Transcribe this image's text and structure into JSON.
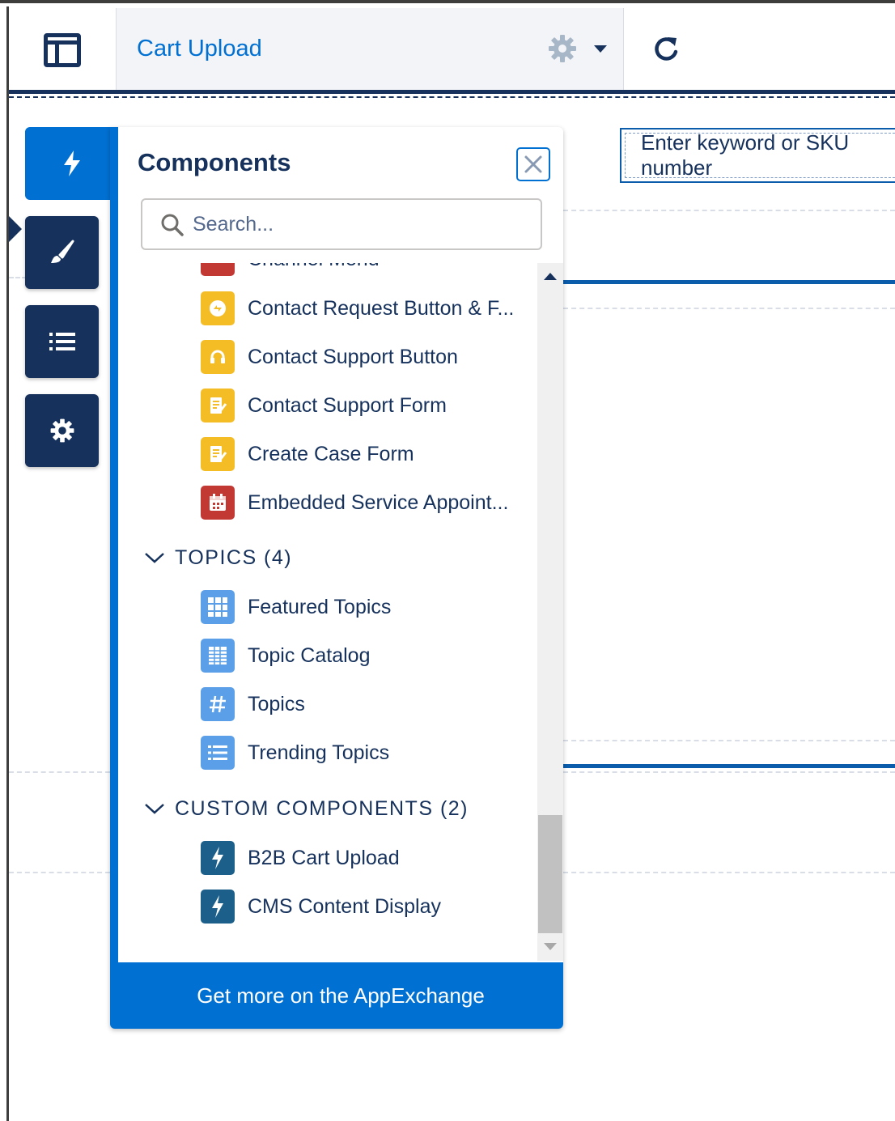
{
  "header": {
    "page_title": "Cart Upload"
  },
  "canvas": {
    "search_placeholder": "Enter keyword or SKU number"
  },
  "rail": {
    "items": [
      {
        "icon": "lightning-icon",
        "active": true
      },
      {
        "icon": "paintbrush-icon",
        "active": false
      },
      {
        "icon": "list-icon",
        "active": false
      },
      {
        "icon": "gear-icon",
        "active": false
      }
    ]
  },
  "panel": {
    "title": "Components",
    "search_placeholder": "Search...",
    "partial_item_label": "Channel Menu",
    "support_items": [
      {
        "label": "Contact Request Button & F...",
        "icon": "contact-request-icon",
        "color": "#f4bc25"
      },
      {
        "label": "Contact Support Button",
        "icon": "headset-icon",
        "color": "#f4bc25"
      },
      {
        "label": "Contact Support Form",
        "icon": "form-icon",
        "color": "#f4bc25"
      },
      {
        "label": "Create Case Form",
        "icon": "form-icon",
        "color": "#f4bc25"
      },
      {
        "label": "Embedded Service Appoint...",
        "icon": "calendar-icon",
        "color": "#c23934"
      }
    ],
    "topics_section": {
      "label": "TOPICS (4)",
      "items": [
        {
          "label": "Featured Topics",
          "icon": "grid-icon",
          "color": "#5a9fe8"
        },
        {
          "label": "Topic Catalog",
          "icon": "catalog-icon",
          "color": "#5a9fe8"
        },
        {
          "label": "Topics",
          "icon": "hash-icon",
          "color": "#5a9fe8"
        },
        {
          "label": "Trending Topics",
          "icon": "list-icon",
          "color": "#5a9fe8"
        }
      ]
    },
    "custom_section": {
      "label": "CUSTOM COMPONENTS (2)",
      "items": [
        {
          "label": "B2B Cart Upload",
          "icon": "lightning-icon",
          "color": "#1b5f8a"
        },
        {
          "label": "CMS Content Display",
          "icon": "lightning-icon",
          "color": "#1b5f8a"
        }
      ]
    },
    "appexchange_label": "Get more on the AppExchange"
  },
  "colors": {
    "brand_blue": "#0070d2",
    "navy": "#16325c",
    "support_yellow": "#f4bc25",
    "service_red": "#c23934",
    "topics_blue": "#5a9fe8",
    "custom_teal": "#1b5f8a"
  }
}
